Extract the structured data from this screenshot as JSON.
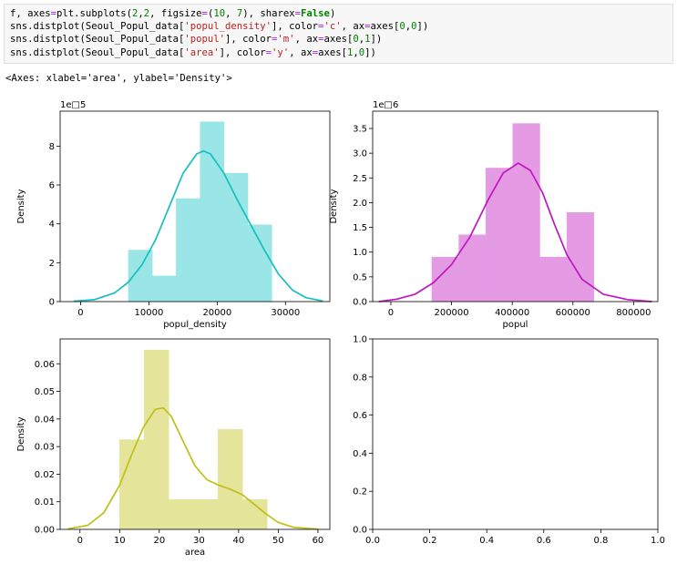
{
  "code": {
    "lines": [
      [
        [
          "f, axes",
          "t"
        ],
        [
          "=",
          "op"
        ],
        [
          "plt.subplots(",
          "t"
        ],
        [
          "2",
          "num"
        ],
        [
          ",",
          "t"
        ],
        [
          "2",
          "num"
        ],
        [
          ", figsize",
          "t"
        ],
        [
          "=",
          "op"
        ],
        [
          "(",
          "t"
        ],
        [
          "10",
          "num"
        ],
        [
          ", ",
          "t"
        ],
        [
          "7",
          "num"
        ],
        [
          "), sharex",
          "t"
        ],
        [
          "=",
          "op"
        ],
        [
          "False",
          "kw"
        ],
        [
          ")",
          "t"
        ]
      ],
      [
        [
          "sns.distplot(Seoul_Popul_data[",
          "t"
        ],
        [
          "'popul_density'",
          "str"
        ],
        [
          "], color",
          "t"
        ],
        [
          "=",
          "op"
        ],
        [
          "'c'",
          "str"
        ],
        [
          ", ax",
          "t"
        ],
        [
          "=",
          "op"
        ],
        [
          "axes[",
          "t"
        ],
        [
          "0",
          "num"
        ],
        [
          ",",
          "t"
        ],
        [
          "0",
          "num"
        ],
        [
          "])",
          "t"
        ]
      ],
      [
        [
          "sns.distplot(Seoul_Popul_data[",
          "t"
        ],
        [
          "'popul'",
          "str"
        ],
        [
          "], color",
          "t"
        ],
        [
          "=",
          "op"
        ],
        [
          "'m'",
          "str"
        ],
        [
          ", ax",
          "t"
        ],
        [
          "=",
          "op"
        ],
        [
          "axes[",
          "t"
        ],
        [
          "0",
          "num"
        ],
        [
          ",",
          "t"
        ],
        [
          "1",
          "num"
        ],
        [
          "])",
          "t"
        ]
      ],
      [
        [
          "sns.distplot(Seoul_Popul_data[",
          "t"
        ],
        [
          "'area'",
          "str"
        ],
        [
          "], color",
          "t"
        ],
        [
          "=",
          "op"
        ],
        [
          "'y'",
          "str"
        ],
        [
          ", ax",
          "t"
        ],
        [
          "=",
          "op"
        ],
        [
          "axes[",
          "t"
        ],
        [
          "1",
          "num"
        ],
        [
          ",",
          "t"
        ],
        [
          "0",
          "num"
        ],
        [
          "])",
          "t"
        ]
      ]
    ]
  },
  "output_text": "<Axes: xlabel='area', ylabel='Density'>",
  "chart_data": [
    {
      "type": "bar",
      "subtype": "hist_kde",
      "color": "#17bfbf",
      "bar_color": "#9ae5e5",
      "xlabel": "popul_density",
      "ylabel": "Density",
      "offset_text": "1e□5",
      "xlim": [
        -3000,
        36500
      ],
      "ylim": [
        0,
        9.8
      ],
      "xticks": [
        0,
        10000,
        20000,
        30000
      ],
      "xtick_labels": [
        "0",
        "10000",
        "20000",
        "30000"
      ],
      "yticks": [
        0,
        2,
        4,
        6,
        8
      ],
      "ytick_labels": [
        "0",
        "2",
        "4",
        "6",
        "8"
      ],
      "bins": [
        {
          "x0": 7000,
          "x1": 10500,
          "y": 2.65
        },
        {
          "x0": 10500,
          "x1": 14000,
          "y": 1.32
        },
        {
          "x0": 14000,
          "x1": 17500,
          "y": 5.3
        },
        {
          "x0": 17500,
          "x1": 21000,
          "y": 9.25
        },
        {
          "x0": 21000,
          "x1": 24500,
          "y": 6.6
        },
        {
          "x0": 24500,
          "x1": 28000,
          "y": 3.95
        }
      ],
      "kde": {
        "x": [
          -1000,
          2000,
          5000,
          7000,
          9000,
          11000,
          13000,
          15000,
          17000,
          18000,
          19000,
          21000,
          23000,
          25000,
          27000,
          29000,
          31000,
          33000,
          35500
        ],
        "y": [
          0.02,
          0.1,
          0.45,
          1.0,
          1.9,
          3.2,
          4.9,
          6.6,
          7.6,
          7.75,
          7.6,
          6.6,
          5.2,
          3.9,
          2.6,
          1.4,
          0.6,
          0.2,
          0.03
        ]
      }
    },
    {
      "type": "bar",
      "subtype": "hist_kde",
      "color": "#bf17bf",
      "bar_color": "#e49be4",
      "xlabel": "popul",
      "ylabel": "Density",
      "offset_text": "1e□6",
      "xlim": [
        -60000,
        880000
      ],
      "ylim": [
        0,
        3.85
      ],
      "xticks": [
        0,
        200000,
        400000,
        600000,
        800000
      ],
      "xtick_labels": [
        "0",
        "200000",
        "400000",
        "600000",
        "800000"
      ],
      "yticks": [
        0,
        0.5,
        1.0,
        1.5,
        2.0,
        2.5,
        3.0,
        3.5
      ],
      "ytick_labels": [
        "0.0",
        "0.5",
        "1.0",
        "1.5",
        "2.0",
        "2.5",
        "3.0",
        "3.5"
      ],
      "bins": [
        {
          "x0": 135000,
          "x1": 224000,
          "y": 0.9
        },
        {
          "x0": 224000,
          "x1": 313000,
          "y": 1.35
        },
        {
          "x0": 313000,
          "x1": 402000,
          "y": 2.7
        },
        {
          "x0": 402000,
          "x1": 491000,
          "y": 3.6
        },
        {
          "x0": 491000,
          "x1": 580000,
          "y": 0.9
        },
        {
          "x0": 580000,
          "x1": 669000,
          "y": 1.8
        }
      ],
      "kde": {
        "x": [
          -40000,
          20000,
          80000,
          140000,
          200000,
          260000,
          320000,
          370000,
          420000,
          460000,
          500000,
          540000,
          580000,
          630000,
          700000,
          780000,
          860000
        ],
        "y": [
          0.0,
          0.05,
          0.15,
          0.38,
          0.75,
          1.3,
          2.05,
          2.6,
          2.8,
          2.65,
          2.2,
          1.55,
          0.95,
          0.45,
          0.15,
          0.04,
          0.0
        ]
      }
    },
    {
      "type": "bar",
      "subtype": "hist_kde",
      "color": "#bfbf17",
      "bar_color": "#e4e49b",
      "xlabel": "area",
      "ylabel": "Density",
      "offset_text": "",
      "xlim": [
        -5,
        63
      ],
      "ylim": [
        0,
        0.069
      ],
      "xticks": [
        0,
        10,
        20,
        30,
        40,
        50,
        60
      ],
      "xtick_labels": [
        "0",
        "10",
        "20",
        "30",
        "40",
        "50",
        "60"
      ],
      "yticks": [
        0,
        0.01,
        0.02,
        0.03,
        0.04,
        0.05,
        0.06
      ],
      "ytick_labels": [
        "0.00",
        "0.01",
        "0.02",
        "0.03",
        "0.04",
        "0.05",
        "0.06"
      ],
      "bins": [
        {
          "x0": 10.0,
          "x1": 16.2,
          "y": 0.0325
        },
        {
          "x0": 16.2,
          "x1": 22.4,
          "y": 0.065
        },
        {
          "x0": 22.4,
          "x1": 28.6,
          "y": 0.0108
        },
        {
          "x0": 28.6,
          "x1": 34.8,
          "y": 0.0108
        },
        {
          "x0": 34.8,
          "x1": 41.0,
          "y": 0.0362
        },
        {
          "x0": 41.0,
          "x1": 47.2,
          "y": 0.0108
        }
      ],
      "kde": {
        "x": [
          -3,
          2,
          6,
          10,
          13,
          16,
          19,
          21,
          23,
          26,
          29,
          32,
          35,
          38,
          41,
          44,
          47,
          50,
          54,
          60
        ],
        "y": [
          0.0002,
          0.0015,
          0.006,
          0.016,
          0.027,
          0.037,
          0.0435,
          0.044,
          0.041,
          0.032,
          0.023,
          0.018,
          0.016,
          0.0145,
          0.0125,
          0.009,
          0.0055,
          0.0025,
          0.0007,
          0.0001
        ]
      }
    },
    {
      "type": "line",
      "subtype": "empty",
      "xlabel": "",
      "ylabel": "",
      "offset_text": "",
      "xlim": [
        0,
        1
      ],
      "ylim": [
        0,
        1
      ],
      "xticks": [
        0,
        0.2,
        0.4,
        0.6,
        0.8,
        1.0
      ],
      "xtick_labels": [
        "0.0",
        "0.2",
        "0.4",
        "0.6",
        "0.8",
        "1.0"
      ],
      "yticks": [
        0,
        0.2,
        0.4,
        0.6,
        0.8,
        1.0
      ],
      "ytick_labels": [
        "0.0",
        "0.2",
        "0.4",
        "0.6",
        "0.8",
        "1.0"
      ],
      "bins": [],
      "kde": null
    }
  ]
}
